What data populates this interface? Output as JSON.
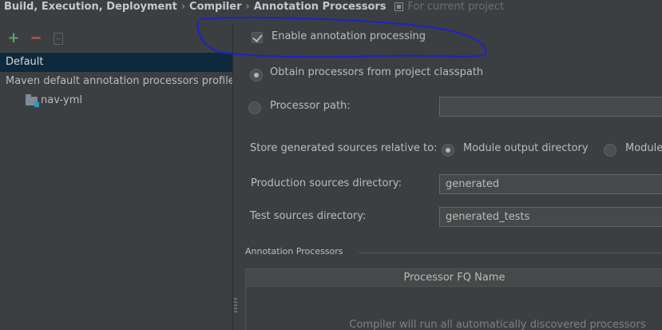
{
  "breadcrumb": {
    "items": [
      "Build, Execution, Deployment",
      "Compiler",
      "Annotation Processors"
    ],
    "separator": "›",
    "scope_label": "For current project"
  },
  "toolbar": {
    "add_glyph": "+",
    "remove_glyph": "−"
  },
  "profiles": {
    "items": [
      "Default",
      "Maven default annotation processors profile"
    ],
    "selected": "Default",
    "module": "nav-yml"
  },
  "settings": {
    "enable_label": "Enable annotation processing",
    "enable_checked": true,
    "obtain_label": "Obtain processors from project classpath",
    "processor_path_label": "Processor path:",
    "processor_path_value": "",
    "store_label": "Store generated sources relative to:",
    "module_output_label": "Module output directory",
    "module_content_label": "Module",
    "production_label": "Production sources directory:",
    "production_value": "generated",
    "test_label": "Test sources directory:",
    "test_value": "generated_tests"
  },
  "annotation_processors": {
    "title": "Annotation Processors",
    "column": "Processor FQ Name",
    "empty_text": "Compiler will run all automatically discovered processors"
  },
  "colors": {
    "background": "#3c3f41",
    "selection": "#0d293e",
    "annotation_ink": "#1a23c9",
    "add_green": "#59a869",
    "remove_red": "#c75450"
  }
}
